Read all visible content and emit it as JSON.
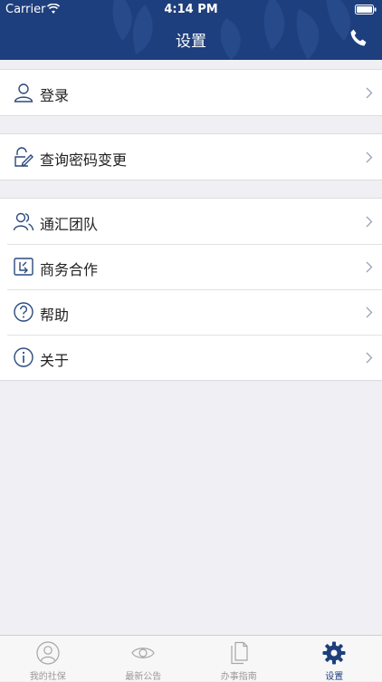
{
  "status_bar": {
    "carrier": "Carrier",
    "time": "4:14 PM"
  },
  "nav": {
    "title": "设置",
    "phone_icon": "phone-icon"
  },
  "colors": {
    "brand": "#1e3f7d",
    "icon_blue": "#2b4a7e",
    "chevron": "#9aa3b5",
    "tab_inactive": "#999999"
  },
  "groups": [
    {
      "items": [
        {
          "label": "登录",
          "icon": "user-icon"
        }
      ]
    },
    {
      "items": [
        {
          "label": "查询密码变更",
          "icon": "edit-password-icon"
        }
      ]
    },
    {
      "items": [
        {
          "label": "通汇团队",
          "icon": "team-icon"
        },
        {
          "label": "商务合作",
          "icon": "cooperation-icon"
        },
        {
          "label": "帮助",
          "icon": "help-icon"
        },
        {
          "label": "关于",
          "icon": "info-icon"
        }
      ]
    }
  ],
  "tabbar": {
    "tabs": [
      {
        "label": "我的社保",
        "icon": "profile-icon",
        "active": false
      },
      {
        "label": "最新公告",
        "icon": "eye-icon",
        "active": false
      },
      {
        "label": "办事指南",
        "icon": "document-icon",
        "active": false
      },
      {
        "label": "设置",
        "icon": "gear-icon",
        "active": true
      }
    ]
  }
}
